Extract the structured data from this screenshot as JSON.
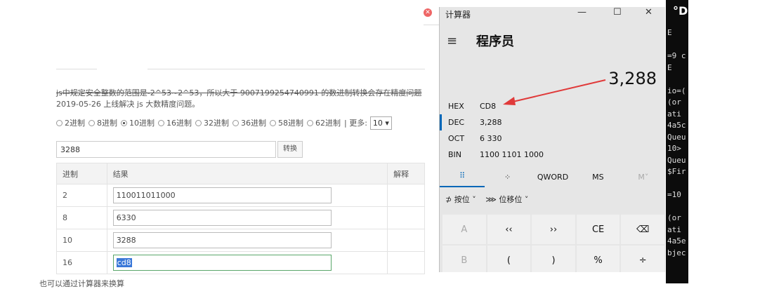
{
  "web": {
    "notice": "js中规定安全整数的范围是-2^53~2^53，所以大于 9007199254740991 的数进制转换会存在精度问题",
    "update": "2019-05-26 上线解决 js 大数精度问题。",
    "radios": [
      {
        "label": "2进制",
        "checked": false
      },
      {
        "label": "8进制",
        "checked": false
      },
      {
        "label": "10进制",
        "checked": true
      },
      {
        "label": "16进制",
        "checked": false
      },
      {
        "label": "32进制",
        "checked": false
      },
      {
        "label": "36进制",
        "checked": false
      },
      {
        "label": "58进制",
        "checked": false
      },
      {
        "label": "62进制",
        "checked": false
      }
    ],
    "more_label": "| 更多:",
    "more_value": "10 ▾",
    "input_value": "3288",
    "convert_label": "转换",
    "table": {
      "headers": [
        "进制",
        "结果",
        "解释"
      ],
      "rows": [
        {
          "base": "2",
          "result": "110011011000"
        },
        {
          "base": "8",
          "result": "6330"
        },
        {
          "base": "10",
          "result": "3288"
        },
        {
          "base": "16",
          "result": "cd8"
        }
      ]
    },
    "bottom_text": "也可以通过计算器来换算"
  },
  "calc": {
    "title": "计算器",
    "controls": [
      "—",
      "☐",
      "✕"
    ],
    "menu_icon": "≡",
    "mode": "程序员",
    "display": "3,288",
    "radix": [
      {
        "name": "HEX",
        "value": "CD8",
        "active": false
      },
      {
        "name": "DEC",
        "value": "3,288",
        "active": true
      },
      {
        "name": "OCT",
        "value": "6 330",
        "active": false
      },
      {
        "name": "BIN",
        "value": "1100 1101 1000",
        "active": false
      }
    ],
    "row_buttons": [
      "⠿",
      "⁘",
      "QWORD",
      "MS",
      "M˅"
    ],
    "bitwise_label": "按位 ˅",
    "bitshift_label": "位移位 ˅",
    "keys": [
      {
        "label": "A",
        "disabled": true
      },
      {
        "label": "‹‹",
        "disabled": false
      },
      {
        "label": "››",
        "disabled": false
      },
      {
        "label": "CE",
        "disabled": false
      },
      {
        "label": "⌫",
        "disabled": false
      },
      {
        "label": "B",
        "disabled": true
      },
      {
        "label": "(",
        "disabled": false
      },
      {
        "label": ")",
        "disabled": false
      },
      {
        "label": "%",
        "disabled": false
      },
      {
        "label": "÷",
        "disabled": false
      }
    ],
    "accent": "#0067b8"
  },
  "terminal": {
    "title": "°D",
    "lines": [
      "E",
      "",
      "=9 c",
      "E",
      "",
      "io=(",
      " (or",
      "ati",
      "4a5c",
      "Queu",
      "10>",
      "Queu",
      "$Fir",
      "",
      "=10",
      "",
      " (or",
      "ati",
      "4a5e",
      "bjec"
    ]
  },
  "annotation_color": "#e03a3a"
}
